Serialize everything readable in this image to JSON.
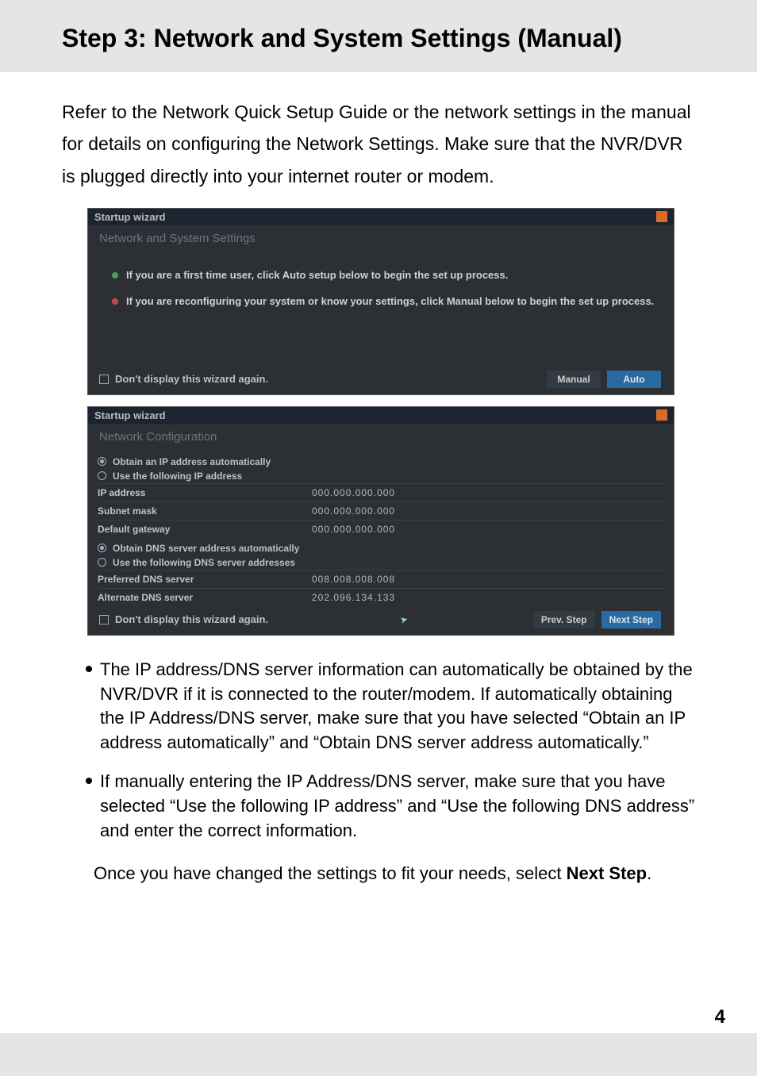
{
  "header": {
    "title": "Step 3: Network and System Settings (Manual)"
  },
  "intro": "Refer to the Network Quick Setup Guide or the network settings in the manual for details on configuring the Network Settings. Make sure that the NVR/DVR is plugged directly into your internet router or modem.",
  "wizard1": {
    "windowTitle": "Startup wizard",
    "subtitle": "Network and System Settings",
    "bullet1": "If you are a first time user, click Auto setup below to begin the set up process.",
    "bullet2": "If you are reconfiguring your system or know your settings, click Manual below to begin the set up process.",
    "dontDisplay": "Don't display this wizard again.",
    "manualBtn": "Manual",
    "autoBtn": "Auto"
  },
  "wizard2": {
    "windowTitle": "Startup wizard",
    "subtitle": "Network Configuration",
    "radioObtainIp": "Obtain an IP address automatically",
    "radioUseIp": "Use the following IP address",
    "ipLabel": "IP address",
    "ipValue": "000.000.000.000",
    "subnetLabel": "Subnet mask",
    "subnetValue": "000.000.000.000",
    "gatewayLabel": "Default gateway",
    "gatewayValue": "000.000.000.000",
    "radioObtainDns": "Obtain DNS server address automatically",
    "radioUseDns": "Use the following DNS server addresses",
    "prefDnsLabel": "Preferred DNS server",
    "prefDnsValue": "008.008.008.008",
    "altDnsLabel": "Alternate DNS server",
    "altDnsValue": "202.096.134.133",
    "dontDisplay": "Don't display this wizard again.",
    "prevBtn": "Prev. Step",
    "nextBtn": "Next Step"
  },
  "notes": {
    "n1": "The IP address/DNS server information can automatically be obtained by the NVR/DVR if it is connected to the router/modem. If automatically obtaining the IP Address/DNS server, make sure that you have selected “Obtain an IP address automatically” and “Obtain DNS server address automatically.”",
    "n2": "If manually entering the IP Address/DNS server, make sure that you have selected “Use the following IP address” and “Use the following DNS address” and enter the correct information."
  },
  "closing": {
    "line": "Once you have changed the settings to fit your needs, select ",
    "nextStep": "Next Step",
    "period": "."
  },
  "pageNumber": "4"
}
